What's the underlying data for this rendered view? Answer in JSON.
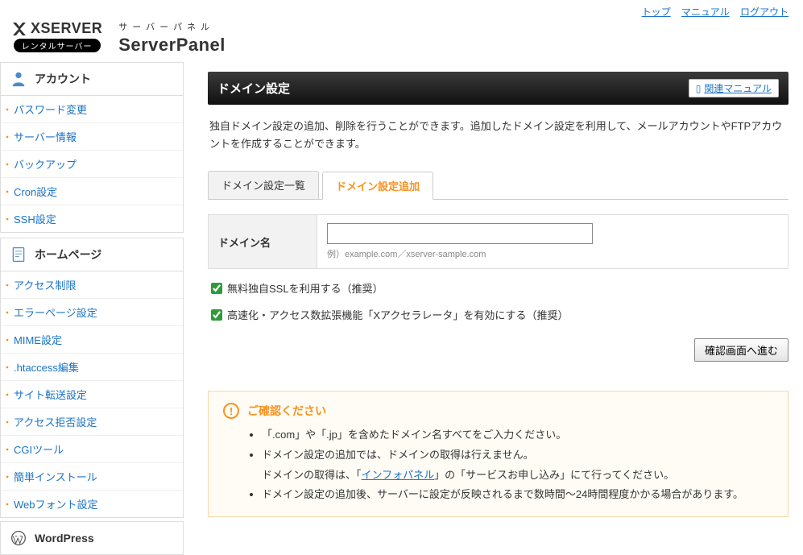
{
  "top_links": {
    "top": "トップ",
    "manual": "マニュアル",
    "logout": "ログアウト"
  },
  "header": {
    "brand": "XSERVER",
    "rental_badge": "レンタルサーバー",
    "panel_jp": "サーバーパネル",
    "panel_en": "ServerPanel"
  },
  "sidebar": {
    "account": {
      "title": "アカウント",
      "items": [
        "パスワード変更",
        "サーバー情報",
        "バックアップ",
        "Cron設定",
        "SSH設定"
      ]
    },
    "homepage": {
      "title": "ホームページ",
      "items": [
        "アクセス制限",
        "エラーページ設定",
        "MIME設定",
        ".htaccess編集",
        "サイト転送設定",
        "アクセス拒否設定",
        "CGIツール",
        "簡単インストール",
        "Webフォント設定"
      ]
    },
    "wordpress": {
      "title": "WordPress"
    }
  },
  "page": {
    "title": "ドメイン設定",
    "manual_btn": "関連マニュアル",
    "description": "独自ドメイン設定の追加、削除を行うことができます。追加したドメイン設定を利用して、メールアカウントやFTPアカウントを作成することができます。"
  },
  "tabs": {
    "list": "ドメイン設定一覧",
    "add": "ドメイン設定追加"
  },
  "form": {
    "domain_label": "ドメイン名",
    "domain_value": "",
    "domain_example": "例）example.com／xserver-sample.com",
    "ssl_label": "無料独自SSLを利用する（推奨）",
    "accel_label": "高速化・アクセス数拡張機能「Xアクセラレータ」を有効にする（推奨）",
    "submit": "確認画面へ進む"
  },
  "notice": {
    "heading": "ご確認ください",
    "items": [
      "「.com」や「.jp」を含めたドメイン名すべてをご入力ください。",
      "ドメイン設定の追加では、ドメインの取得は行えません。",
      "ドメイン設定の追加後、サーバーに設定が反映されるまで数時間～24時間程度かかる場合があります。"
    ],
    "subline_prefix": "ドメインの取得は、「",
    "subline_link": "インフォパネル",
    "subline_suffix": "」の「サービスお申し込み」にて行ってください。"
  }
}
